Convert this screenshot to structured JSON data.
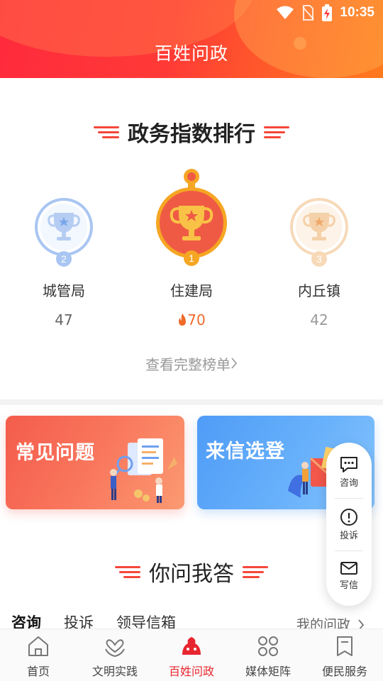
{
  "status_bar": {
    "time": "10:35"
  },
  "header": {
    "title": "百姓问政"
  },
  "ranking": {
    "title": "政务指数排行",
    "items": [
      {
        "rank": "2",
        "name": "城管局",
        "score": "47"
      },
      {
        "rank": "1",
        "name": "住建局",
        "score": "70"
      },
      {
        "rank": "3",
        "name": "内丘镇",
        "score": "42"
      }
    ],
    "more_link": "查看完整榜单",
    "colors": {
      "silver": "#a9c6f2",
      "gold": "#f5a623",
      "gold_inner": "#ef5a45",
      "bronze": "#f7d9b8"
    }
  },
  "cards": {
    "faq": {
      "title": "常见问题"
    },
    "letter": {
      "title": "来信选登"
    }
  },
  "float_panel": {
    "consult": "咨询",
    "complain": "投诉",
    "write": "写信"
  },
  "qa_section": {
    "title": "你问我答"
  },
  "tabs": {
    "items": [
      "咨询",
      "投诉",
      "领导信箱"
    ],
    "my_link": "我的问政"
  },
  "bottom_nav": {
    "items": [
      {
        "label": "首页",
        "icon": "home-icon"
      },
      {
        "label": "文明实践",
        "icon": "heart-hands-icon"
      },
      {
        "label": "百姓问政",
        "icon": "govern-icon"
      },
      {
        "label": "媒体矩阵",
        "icon": "grid-icon"
      },
      {
        "label": "便民服务",
        "icon": "bookmark-icon"
      }
    ],
    "active_color": "#e8262f"
  }
}
